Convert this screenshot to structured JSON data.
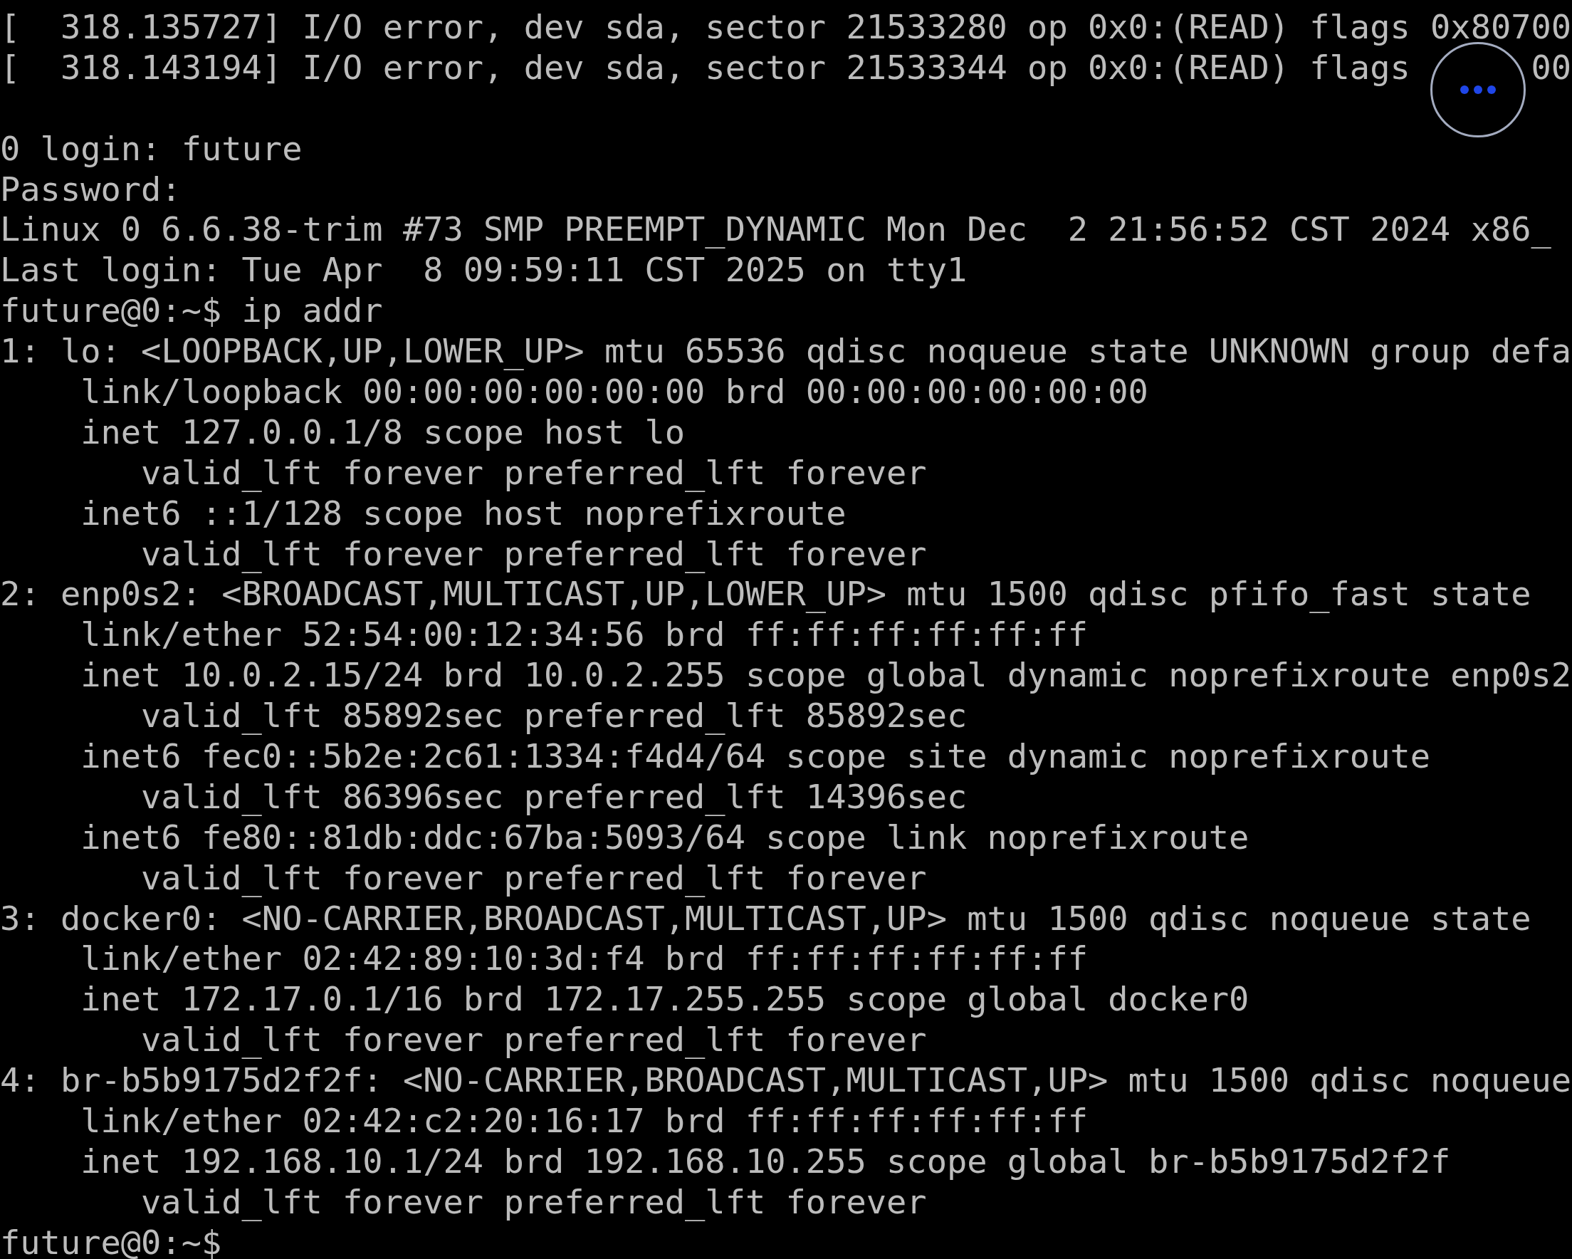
{
  "terminal": {
    "lines": [
      {
        "kind": "text",
        "text": "[  318.135727] I/O error, dev sda, sector 21533280 op 0x0:(READ) flags 0x80700"
      },
      {
        "kind": "text",
        "text": "[  318.143194] I/O error, dev sda, sector 21533344 op 0x0:(READ) flags",
        "tail": "00"
      },
      {
        "kind": "blank"
      },
      {
        "kind": "text",
        "text": "0 login: future"
      },
      {
        "kind": "text",
        "text": "Password:"
      },
      {
        "kind": "text",
        "text": "Linux 0 6.6.38-trim #73 SMP PREEMPT_DYNAMIC Mon Dec  2 21:56:52 CST 2024 x86_"
      },
      {
        "kind": "text",
        "text": "Last login: Tue Apr  8 09:59:11 CST 2025 on tty1"
      },
      {
        "kind": "text",
        "text": "future@0:~$ ip addr"
      },
      {
        "kind": "text",
        "text": "1: lo: <LOOPBACK,UP,LOWER_UP> mtu 65536 qdisc noqueue state UNKNOWN group defa"
      },
      {
        "kind": "text",
        "text": "    link/loopback 00:00:00:00:00:00 brd 00:00:00:00:00:00"
      },
      {
        "kind": "text",
        "text": "    inet 127.0.0.1/8 scope host lo"
      },
      {
        "kind": "text",
        "text": "       valid_lft forever preferred_lft forever"
      },
      {
        "kind": "text",
        "text": "    inet6 ::1/128 scope host noprefixroute"
      },
      {
        "kind": "text",
        "text": "       valid_lft forever preferred_lft forever"
      },
      {
        "kind": "text",
        "text": "2: enp0s2: <BROADCAST,MULTICAST,UP,LOWER_UP> mtu 1500 qdisc pfifo_fast state"
      },
      {
        "kind": "text",
        "text": "    link/ether 52:54:00:12:34:56 brd ff:ff:ff:ff:ff:ff"
      },
      {
        "kind": "text",
        "text": "    inet 10.0.2.15/24 brd 10.0.2.255 scope global dynamic noprefixroute enp0s2"
      },
      {
        "kind": "text",
        "text": "       valid_lft 85892sec preferred_lft 85892sec"
      },
      {
        "kind": "text",
        "text": "    inet6 fec0::5b2e:2c61:1334:f4d4/64 scope site dynamic noprefixroute"
      },
      {
        "kind": "text",
        "text": "       valid_lft 86396sec preferred_lft 14396sec"
      },
      {
        "kind": "text",
        "text": "    inet6 fe80::81db:ddc:67ba:5093/64 scope link noprefixroute"
      },
      {
        "kind": "text",
        "text": "       valid_lft forever preferred_lft forever"
      },
      {
        "kind": "text",
        "text": "3: docker0: <NO-CARRIER,BROADCAST,MULTICAST,UP> mtu 1500 qdisc noqueue state"
      },
      {
        "kind": "text",
        "text": "    link/ether 02:42:89:10:3d:f4 brd ff:ff:ff:ff:ff:ff"
      },
      {
        "kind": "text",
        "text": "    inet 172.17.0.1/16 brd 172.17.255.255 scope global docker0"
      },
      {
        "kind": "text",
        "text": "       valid_lft forever preferred_lft forever"
      },
      {
        "kind": "text",
        "text": "4: br-b5b9175d2f2f: <NO-CARRIER,BROADCAST,MULTICAST,UP> mtu 1500 qdisc noqueue"
      },
      {
        "kind": "text",
        "text": "    link/ether 02:42:c2:20:16:17 brd ff:ff:ff:ff:ff:ff"
      },
      {
        "kind": "text",
        "text": "    inet 192.168.10.1/24 brd 192.168.10.255 scope global br-b5b9175d2f2f"
      },
      {
        "kind": "text",
        "text": "       valid_lft forever preferred_lft forever"
      },
      {
        "kind": "text",
        "text": "future@0:~$"
      }
    ]
  }
}
